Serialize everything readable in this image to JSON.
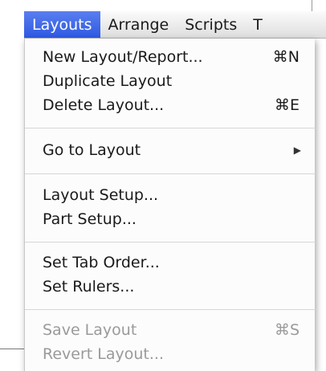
{
  "menubar": {
    "items": [
      "Layouts",
      "Arrange",
      "Scripts",
      "T"
    ]
  },
  "menu": {
    "items": [
      {
        "label": "New Layout/Report...",
        "shortcut": "⌘N"
      },
      {
        "label": "Duplicate Layout",
        "shortcut": ""
      },
      {
        "label": "Delete Layout...",
        "shortcut": "⌘E"
      },
      {
        "label": "Go to Layout",
        "shortcut": ""
      },
      {
        "label": "Layout Setup...",
        "shortcut": ""
      },
      {
        "label": "Part Setup...",
        "shortcut": ""
      },
      {
        "label": "Set Tab Order...",
        "shortcut": ""
      },
      {
        "label": "Set Rulers...",
        "shortcut": ""
      },
      {
        "label": "Save Layout",
        "shortcut": "⌘S"
      },
      {
        "label": "Revert Layout...",
        "shortcut": ""
      }
    ],
    "submenu_arrow": "▶"
  },
  "colors": {
    "highlight": "#2e5ae2",
    "disabled_text": "#9a9a9a"
  }
}
